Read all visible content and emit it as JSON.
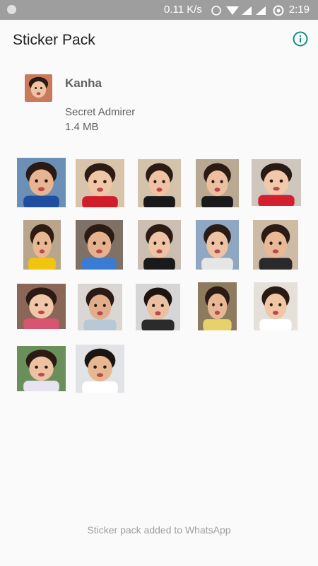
{
  "status_bar": {
    "speed": "0.11 K/s",
    "time": "2:19"
  },
  "app_bar": {
    "title": "Sticker Pack",
    "info_icon": "info-icon"
  },
  "pack": {
    "name": "Kanha",
    "author": "Secret Admirer",
    "size": "1.4 MB"
  },
  "stickers": [
    {
      "bg": "#6b8fb5",
      "face": "#e7b593",
      "hair": "#2a1a14",
      "shirt": "#1e4ea0"
    },
    {
      "bg": "#d8c4aa",
      "face": "#f0c7a6",
      "hair": "#2e1c14",
      "shirt": "#d11d2b"
    },
    {
      "bg": "#d5c2ac",
      "face": "#eec2a2",
      "hair": "#2b1b14",
      "shirt": "#1a1a1a"
    },
    {
      "bg": "#b9a892",
      "face": "#ecbf9e",
      "hair": "#2b1b14",
      "shirt": "#1a1a1a"
    },
    {
      "bg": "#cfc7bd",
      "face": "#f1c8aa",
      "hair": "#2a1a14",
      "shirt": "#d3202f"
    },
    {
      "bg": "#b9a58c",
      "face": "#e8b892",
      "hair": "#2c1c12",
      "shirt": "#f1c40f"
    },
    {
      "bg": "#7f7165",
      "face": "#e6b28e",
      "hair": "#2b1b14",
      "shirt": "#3a7bd5"
    },
    {
      "bg": "#cbbfb2",
      "face": "#eec4a5",
      "hair": "#2b1b14",
      "shirt": "#1a1a1a"
    },
    {
      "bg": "#8fa7c2",
      "face": "#edc3a4",
      "hair": "#2b1b14",
      "shirt": "#e6e6e6"
    },
    {
      "bg": "#cdbba6",
      "face": "#e9b995",
      "hair": "#2b1b14",
      "shirt": "#2a2a2a"
    },
    {
      "bg": "#8a6656",
      "face": "#f0c7a8",
      "hair": "#2b1b14",
      "shirt": "#d85570"
    },
    {
      "bg": "#d9d6d3",
      "face": "#e2ad8a",
      "hair": "#2b1b14",
      "shirt": "#b7c9d6"
    },
    {
      "bg": "#d6d6d6",
      "face": "#ebc0a0",
      "hair": "#1e1410",
      "shirt": "#2b2b2b"
    },
    {
      "bg": "#8d7b5f",
      "face": "#e8b794",
      "hair": "#2b1b14",
      "shirt": "#e6d16a"
    },
    {
      "bg": "#e5e0da",
      "face": "#f0c6a4",
      "hair": "#2a1a14",
      "shirt": "#ffffff"
    },
    {
      "bg": "#6b8f5b",
      "face": "#edc1a2",
      "hair": "#2b1b14",
      "shirt": "#e8e3f0"
    },
    {
      "bg": "#e2e3e6",
      "face": "#e6b791",
      "hair": "#1c1410",
      "shirt": "#ffffff"
    }
  ],
  "footer": {
    "text": "Sticker pack added to WhatsApp"
  },
  "colors": {
    "accent": "#128C7E",
    "status_bar": "#9e9e9e"
  }
}
